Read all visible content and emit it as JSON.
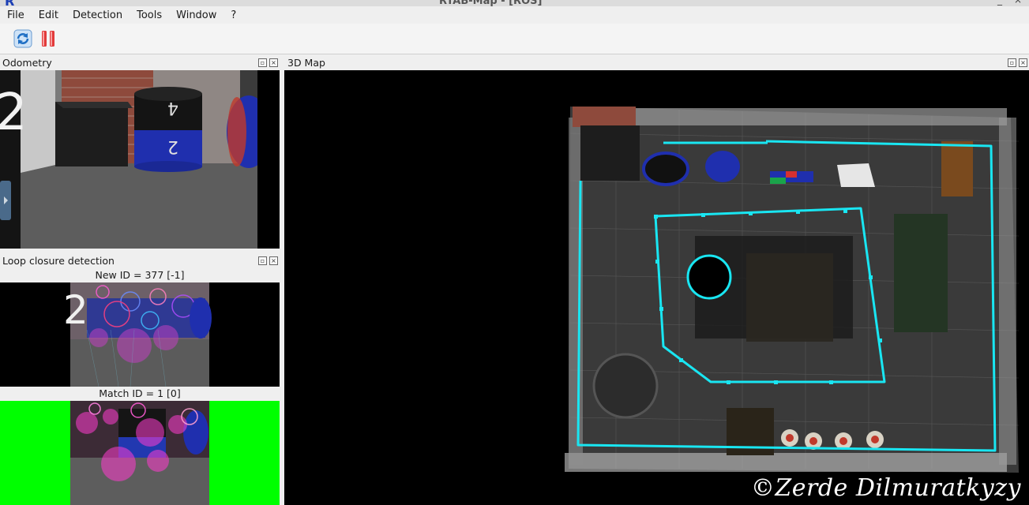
{
  "window": {
    "title": "RTAB-Map - [ROS]",
    "app_letter": "R",
    "minimize": "_",
    "close": "×"
  },
  "menu": [
    "File",
    "Edit",
    "Detection",
    "Tools",
    "Window",
    "?"
  ],
  "toolbar": {
    "refresh_icon": "refresh-icon",
    "pause_icon": "pause-icon"
  },
  "docks": {
    "odometry": {
      "title": "Odometry"
    },
    "map3d": {
      "title": "3D Map"
    },
    "loop": {
      "title": "Loop closure detection",
      "new_id": "New ID = 377 [-1]",
      "match_id": "Match ID = 1 [0]"
    }
  },
  "watermark": "©Zerde Dilmuratkyzy",
  "colors": {
    "trajectory": "#19e6f2",
    "match_bg": "#00ff00",
    "map_bg": "#000000"
  }
}
